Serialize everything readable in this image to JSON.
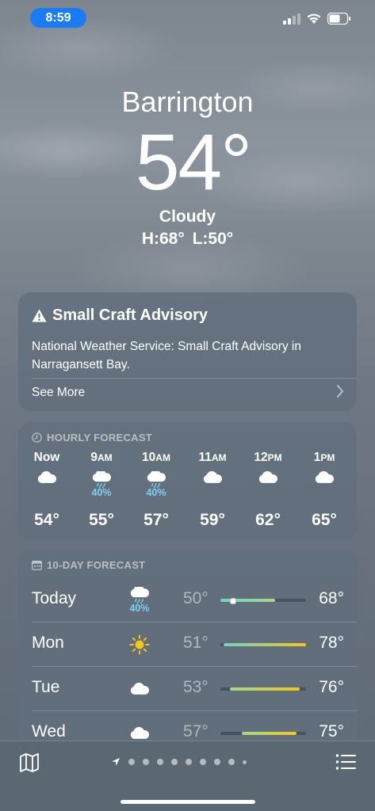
{
  "status_bar": {
    "time": "8:59"
  },
  "location": {
    "city": "Barrington",
    "temperature": "54°",
    "condition": "Cloudy",
    "high_low": "H:68°  L:50°"
  },
  "advisory": {
    "title": "Small Craft Advisory",
    "body": "National Weather Service: Small Craft Advisory in Narragansett Bay.",
    "see_more": "See More"
  },
  "hourly": {
    "header": "HOURLY FORECAST",
    "items": [
      {
        "time": "Now",
        "icon": "cloud-icon",
        "precip": "",
        "temp": "54°"
      },
      {
        "time": "9AM",
        "icon": "cloud-rain-icon",
        "precip": "40%",
        "temp": "55°"
      },
      {
        "time": "10AM",
        "icon": "cloud-rain-icon",
        "precip": "40%",
        "temp": "57°"
      },
      {
        "time": "11AM",
        "icon": "cloud-icon",
        "precip": "",
        "temp": "59°"
      },
      {
        "time": "12PM",
        "icon": "cloud-icon",
        "precip": "",
        "temp": "62°"
      },
      {
        "time": "1PM",
        "icon": "cloud-icon",
        "precip": "",
        "temp": "65°"
      }
    ]
  },
  "ten_day": {
    "header": "10-DAY FORECAST",
    "range_min": 50,
    "range_max": 78,
    "days": [
      {
        "day": "Today",
        "icon": "cloud-rain-icon",
        "precip": "40%",
        "low": "50°",
        "high": "68°",
        "low_val": 50,
        "high_val": 68,
        "current_val": 54
      },
      {
        "day": "Mon",
        "icon": "sun-icon",
        "precip": "",
        "low": "51°",
        "high": "78°",
        "low_val": 51,
        "high_val": 78
      },
      {
        "day": "Tue",
        "icon": "cloud-icon",
        "precip": "",
        "low": "53°",
        "high": "76°",
        "low_val": 53,
        "high_val": 76
      },
      {
        "day": "Wed",
        "icon": "cloud-icon",
        "precip": "",
        "low": "57°",
        "high": "75°",
        "low_val": 57,
        "high_val": 75
      }
    ]
  },
  "bottom_bar": {
    "page_count": 10,
    "current_page": 0
  },
  "colors": {
    "precip": "#7cd0f4",
    "sun": "#f5c518",
    "time_pill": "#1a7cf5"
  }
}
